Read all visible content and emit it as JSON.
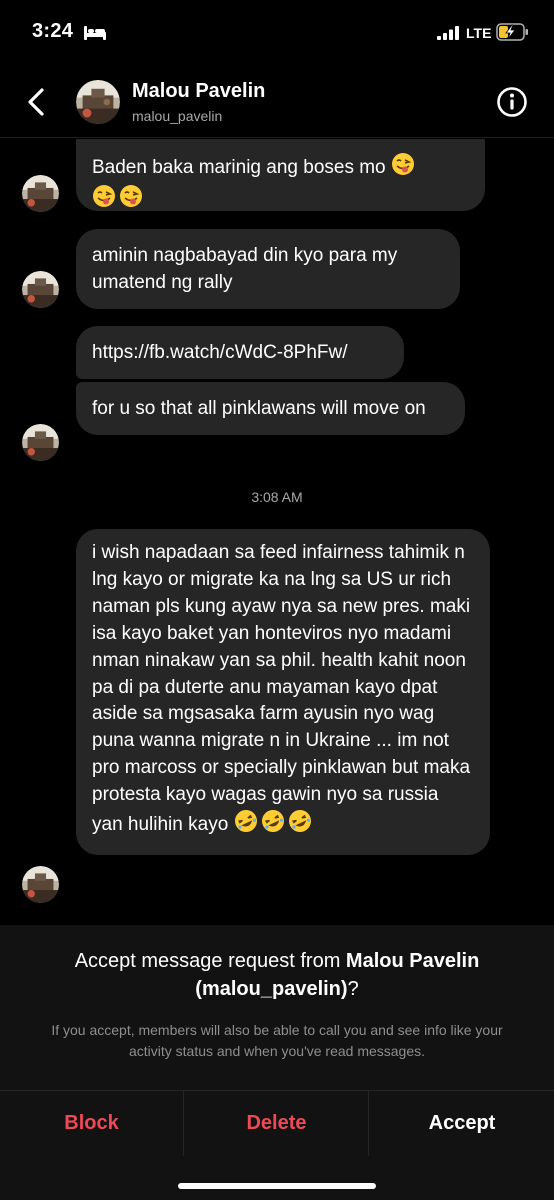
{
  "status_bar": {
    "time": "3:24",
    "network": "LTE"
  },
  "header": {
    "name": "Malou Pavelin",
    "username": "malou_pavelin"
  },
  "messages": [
    {
      "text": "Baden baka marinig ang boses mo",
      "emoji": [
        "winking-tongue",
        "winking-tongue",
        "winking-tongue"
      ]
    },
    {
      "text": "aminin nagbabayad din kyo para my umatend ng rally"
    },
    {
      "text": "https://fb.watch/cWdC-8PhFw/"
    },
    {
      "text": "for u so that all pinklawans will move on"
    },
    {
      "text": "i wish napadaan sa feed infairness tahimik n lng kayo or migrate ka na lng sa US ur rich naman pls kung ayaw nya sa new pres. maki isa kayo baket yan honteviros nyo madami nman ninakaw yan sa phil. health kahit noon pa di pa duterte anu mayaman kayo dpat aside sa mgsasaka farm ayusin nyo wag puna wanna migrate n in Ukraine ... im not pro marcoss or specially pinklawan but maka protesta kayo wagas gawin nyo sa russia yan hulihin kayo",
      "emoji": [
        "rofl",
        "rofl",
        "rofl"
      ]
    }
  ],
  "timestamp": "3:08 AM",
  "request": {
    "prefix": "Accept message request from ",
    "name": "Malou Pavelin",
    "username": "(malou_pavelin)",
    "suffix": "?",
    "info": "If you accept, members will also be able to call you and see info like your activity status and when you've read messages."
  },
  "actions": {
    "block": "Block",
    "delete": "Delete",
    "accept": "Accept"
  },
  "colors": {
    "bubble": "#262626",
    "danger": "#ed4956",
    "panel": "#121212",
    "muted": "#8e8e8e"
  }
}
